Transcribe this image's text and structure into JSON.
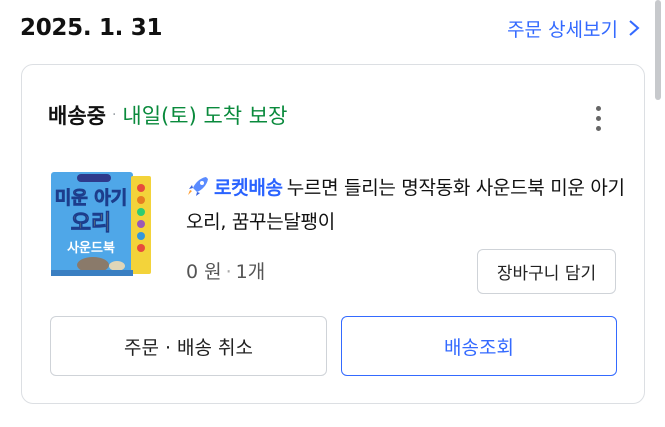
{
  "order": {
    "date": "2025. 1. 31",
    "detail_link": "주문 상세보기"
  },
  "shipment": {
    "status": "배송중",
    "separator": "·",
    "delivery_promise": "내일(토) 도착 보장"
  },
  "product": {
    "rocket_label": "로켓배송",
    "title": "누르면 들리는 명작동화 사운드북 미운 아기 오리, 꿈꾸는달팽이",
    "price": "0 원",
    "separator": "·",
    "quantity": "1개",
    "thumbnail_text": {
      "line1": "미운 아기",
      "line2": "오리",
      "line3": "사운드북"
    }
  },
  "buttons": {
    "add_to_cart": "장바구니 담기",
    "cancel": "주문 · 배송 취소",
    "track": "배송조회"
  },
  "colors": {
    "accent_blue": "#346aff",
    "delivery_green": "#0a8a3c",
    "rocket_blue": "#2a63ff"
  },
  "icons": {
    "detail": "chevron-right-icon",
    "more": "more-vertical-icon",
    "rocket": "rocket-icon"
  }
}
